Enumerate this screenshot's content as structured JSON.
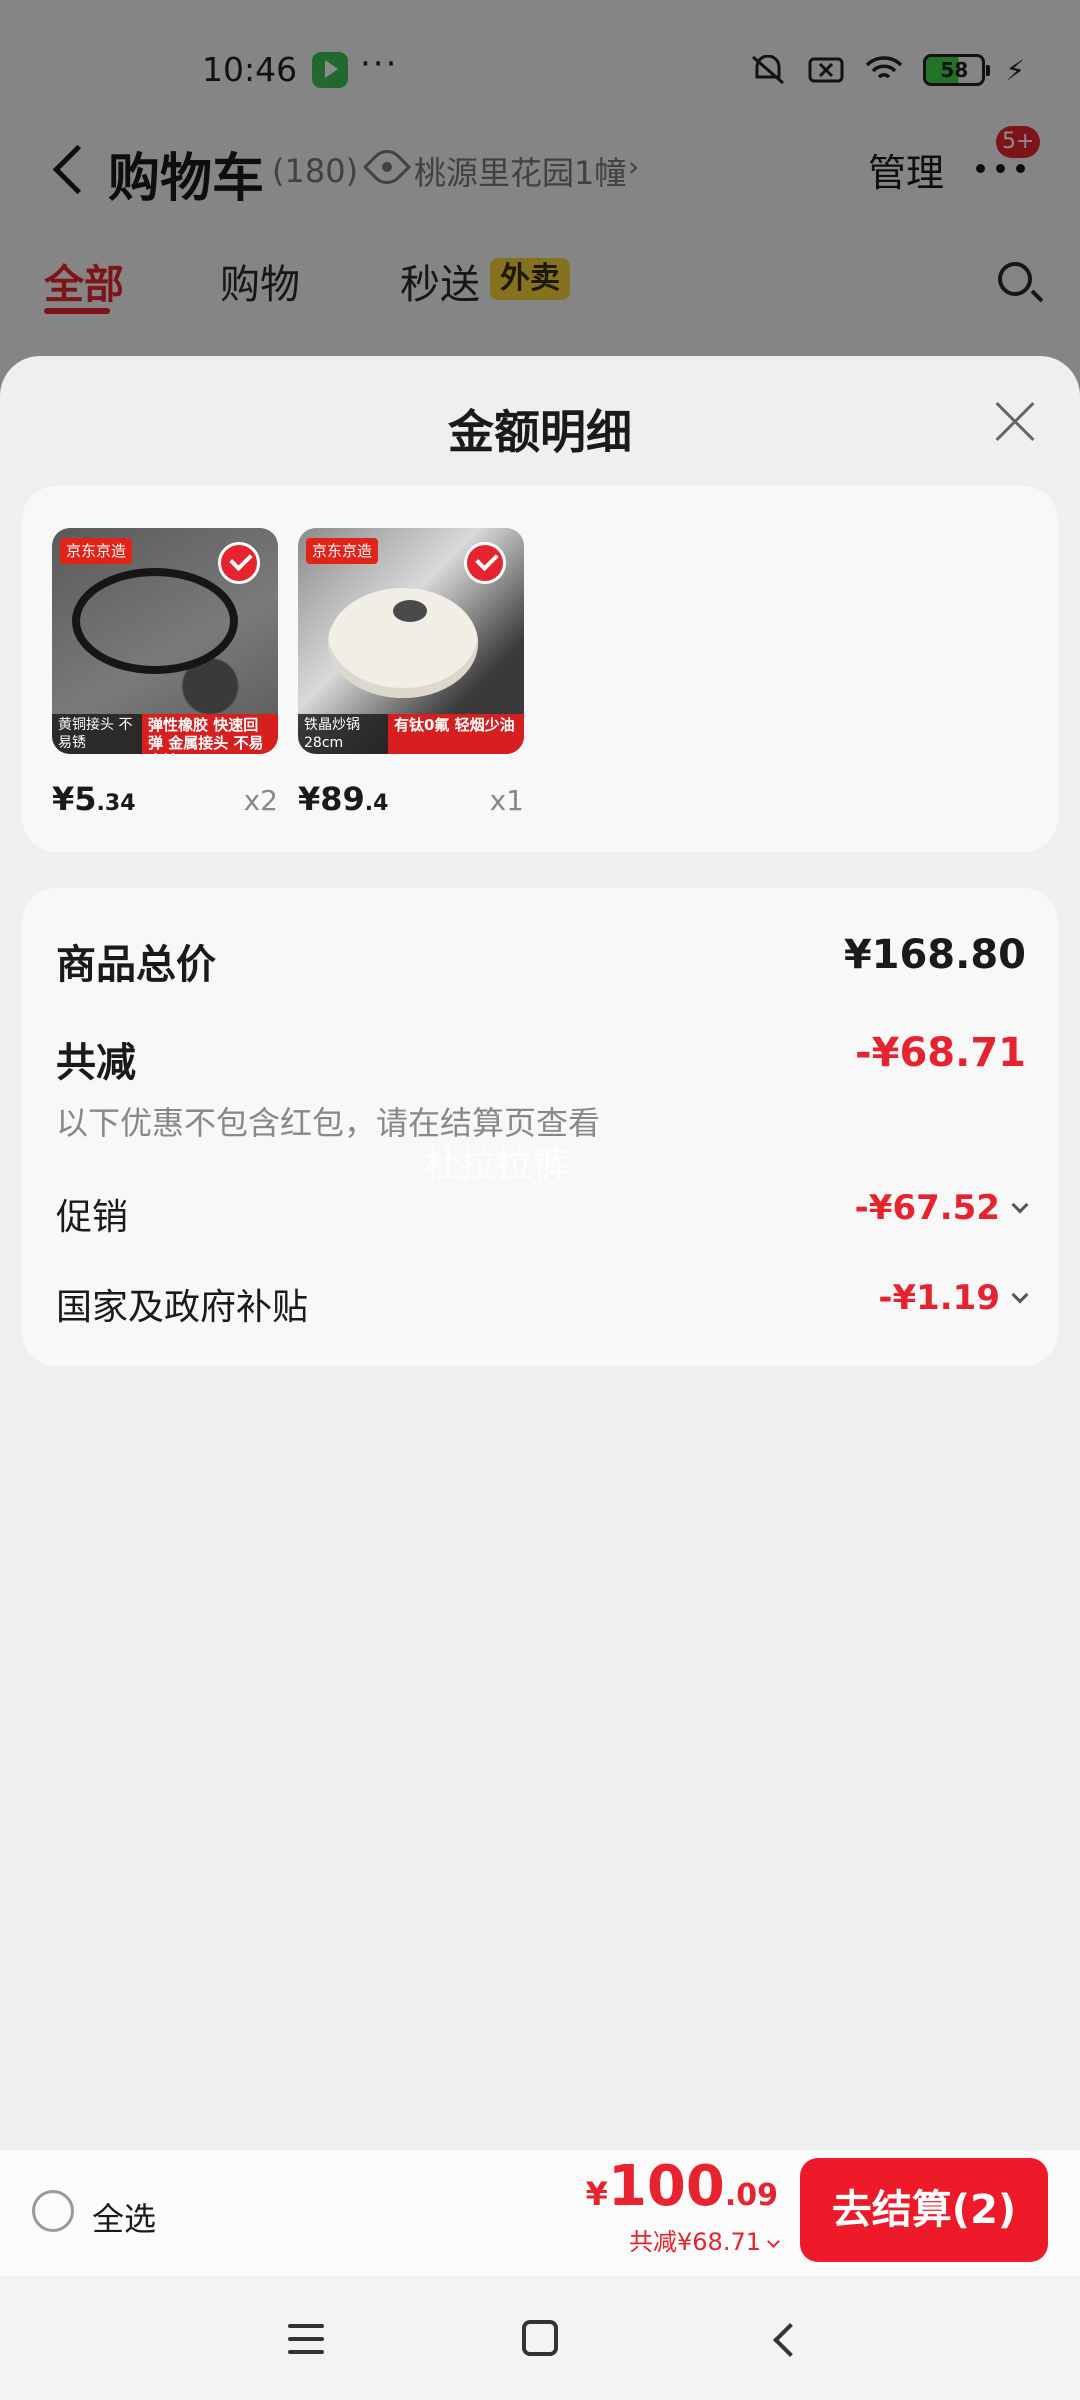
{
  "status_bar": {
    "time": "10:46",
    "battery": "58"
  },
  "header": {
    "title": "购物车",
    "count": "(180)",
    "address": "桃源里花园1幢",
    "manage": "管理",
    "badge": "5+"
  },
  "tabs": [
    {
      "label": "全部",
      "active": true
    },
    {
      "label": "购物"
    },
    {
      "label": "秒送",
      "tag": "外卖"
    }
  ],
  "sheet": {
    "title": "金额明细",
    "products": [
      {
        "brand": "京东京造",
        "caption_dark": "黄铜接头 不易锈",
        "caption_red": "弹性橡胶 快速回弹 金属接头 不易腐蚀",
        "price_int": "¥5",
        "price_dec": ".34",
        "qty": "x2",
        "selected": true
      },
      {
        "brand": "京东京造",
        "caption_dark": "铁晶炒锅 28cm",
        "caption_red": "有钛0氟 轻烟少油",
        "price_int": "¥89",
        "price_dec": ".4",
        "qty": "x1",
        "selected": true
      }
    ],
    "summary": {
      "subtotal_label": "商品总价",
      "subtotal_value": "¥168.80",
      "discount_label": "共减",
      "discount_value": "-¥68.71",
      "note": "以下优惠不包含红包，请在结算页查看",
      "promo_label": "促销",
      "promo_value": "-¥67.52",
      "subsidy_label": "国家及政府补贴",
      "subsidy_value": "-¥1.19"
    },
    "watermark": "杜拉拉裤"
  },
  "bottom": {
    "select_all": "全选",
    "total_currency": "¥",
    "total_int": "100",
    "total_dec": ".09",
    "total_sub": "共减¥68.71",
    "checkout": "去结算(2)"
  },
  "colors": {
    "accent": "#e6232e",
    "checkout_bg": "#ee1a2a",
    "tag_yellow": "#f3d03a"
  }
}
